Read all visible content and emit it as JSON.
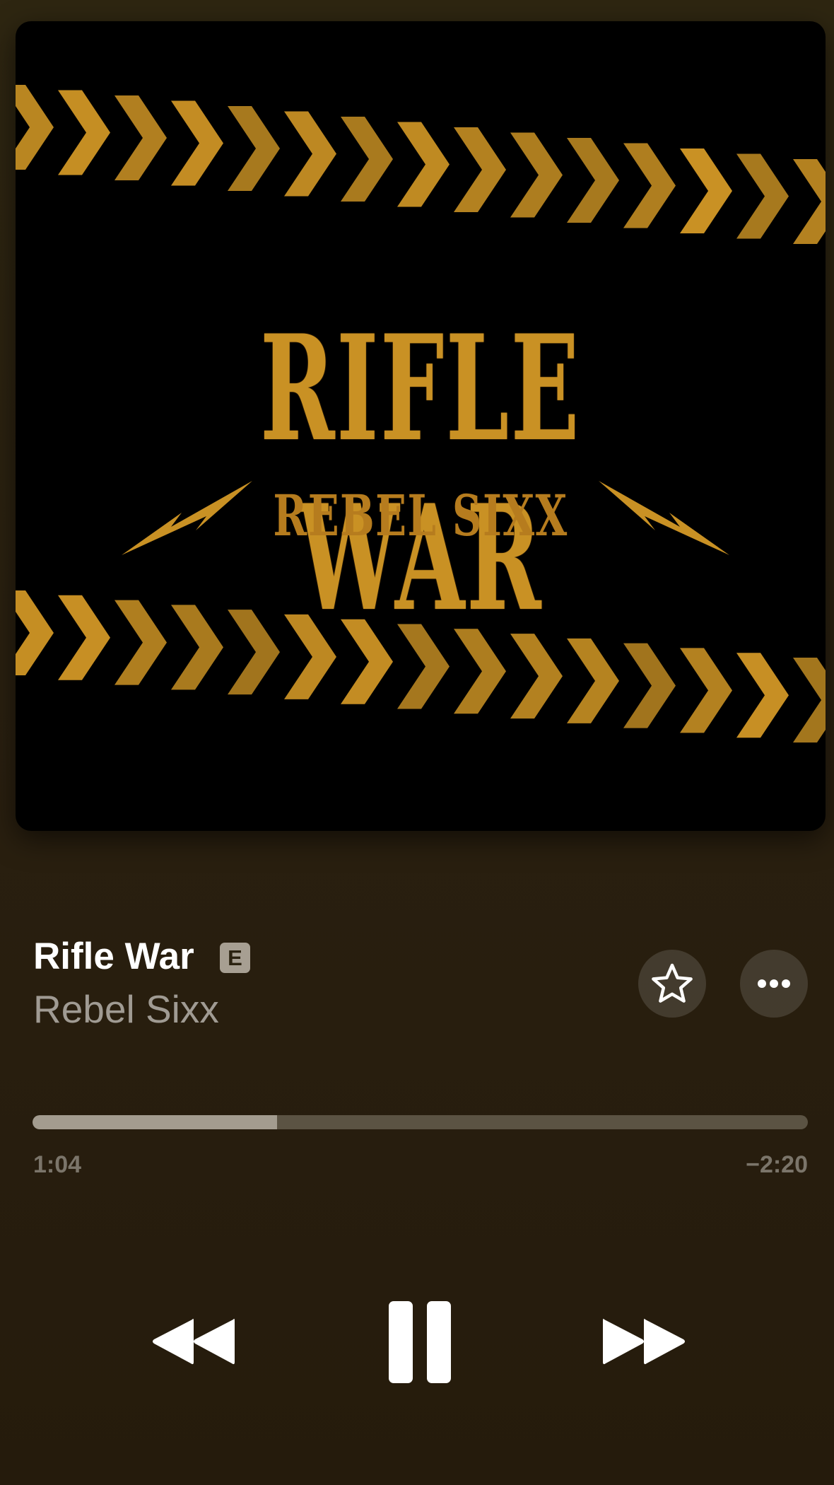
{
  "artwork": {
    "title_text": "RIFLE WAR",
    "subtitle_text": "REBEL SIXX",
    "accent_color": "#c99124"
  },
  "track": {
    "title": "Rifle War",
    "explicit_badge": "E",
    "artist": "Rebel Sixx"
  },
  "actions": {
    "favorite_icon": "star-icon",
    "more_icon": "ellipsis-icon"
  },
  "playback": {
    "elapsed": "1:04",
    "remaining": "−2:20",
    "progress_fraction": 0.315
  },
  "controls": {
    "previous_icon": "backward-icon",
    "play_pause_icon": "pause-icon",
    "next_icon": "forward-icon"
  }
}
